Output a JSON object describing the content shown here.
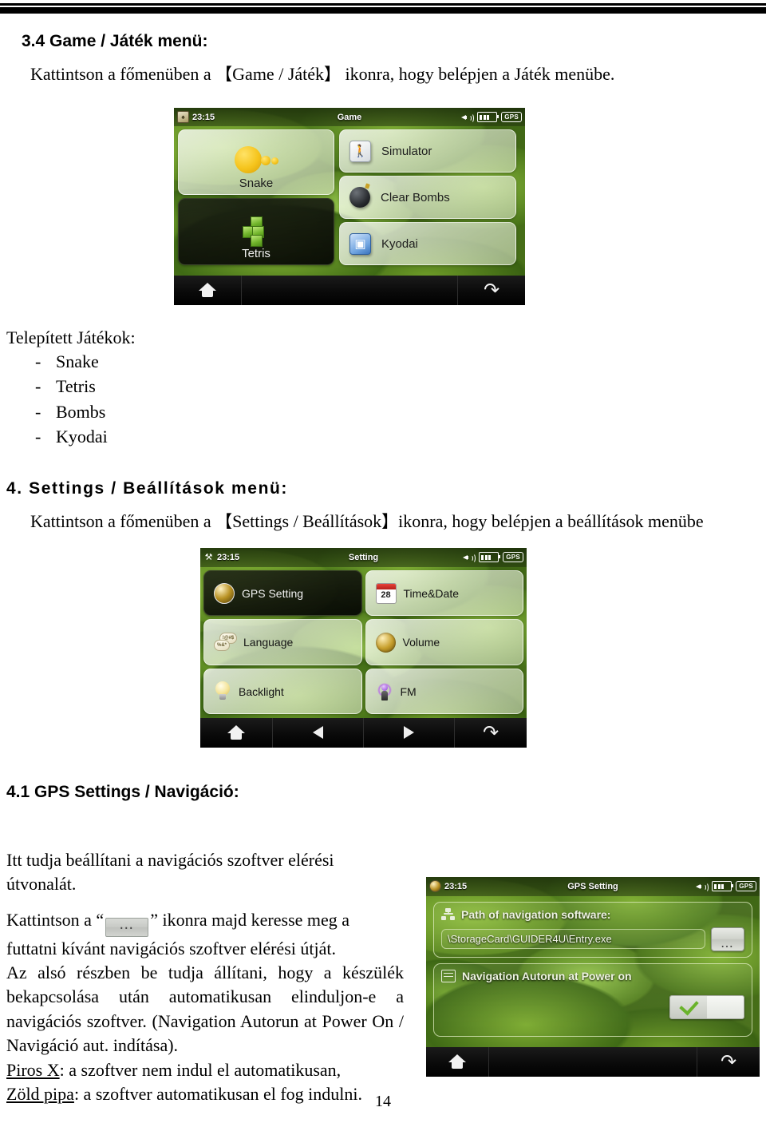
{
  "document": {
    "page_number": "14"
  },
  "section_34": {
    "heading": "3.4 Game / Játék menü:",
    "intro_before": "Kattintson a főmenüben a",
    "bracket_open": "【",
    "bracket_label": "Game / Játék",
    "bracket_close": "】",
    "intro_after": "ikonra, hogy belépjen a Játék menübe."
  },
  "game_screen": {
    "status": {
      "app_icon": "cards-icon",
      "time": "23:15",
      "title": "Game",
      "speaker_icon": "speaker-icon",
      "battery_icon": "battery-icon",
      "gps_label": "GPS"
    },
    "tiles_left": [
      {
        "label": "Snake",
        "icon": "snake-icon",
        "style": "light"
      },
      {
        "label": "Tetris",
        "icon": "tetris-icon",
        "style": "dark"
      }
    ],
    "tiles_right": [
      {
        "label": "Simulator",
        "icon": "simulator-icon"
      },
      {
        "label": "Clear Bombs",
        "icon": "bomb-icon"
      },
      {
        "label": "Kyodai",
        "icon": "kyodai-icon"
      }
    ],
    "toolbar": [
      {
        "name": "home-button",
        "icon": "home-icon"
      },
      {
        "name": "back-button",
        "icon": "back-arrow-icon"
      }
    ]
  },
  "installed_games": {
    "heading": "Telepített Játékok:",
    "bullet": "-",
    "items": [
      "Snake",
      "Tetris",
      "Bombs",
      "Kyodai"
    ]
  },
  "section_4": {
    "heading": "4. Settings / Beállítások menü:",
    "intro_before": "Kattintson a főmenüben a",
    "bracket_open": "【",
    "bracket_label": "Settings / Beállítások",
    "bracket_close": "】",
    "intro_after": "ikonra, hogy belépjen a beállítások menübe"
  },
  "settings_screen": {
    "status": {
      "app_icon": "tools-icon",
      "time": "23:15",
      "title": "Setting",
      "speaker_icon": "speaker-icon",
      "battery_icon": "battery-icon",
      "gps_label": "GPS"
    },
    "tiles": [
      {
        "label": "GPS Setting",
        "icon": "gps-globe-icon",
        "selected": true
      },
      {
        "label": "Time&Date",
        "icon": "calendar-icon",
        "day": "28"
      },
      {
        "label": "Language",
        "icon": "language-icon",
        "bubble1": "!@#$",
        "bubble2": "%&*"
      },
      {
        "label": "Volume",
        "icon": "volume-icon"
      },
      {
        "label": "Backlight",
        "icon": "lightbulb-icon"
      },
      {
        "label": "FM",
        "icon": "fm-transmitter-icon"
      }
    ],
    "toolbar": [
      {
        "name": "home-button",
        "icon": "home-icon"
      },
      {
        "name": "prev-button",
        "icon": "left-arrow-icon"
      },
      {
        "name": "next-button",
        "icon": "right-arrow-icon"
      },
      {
        "name": "back-button",
        "icon": "back-arrow-icon"
      }
    ]
  },
  "section_41": {
    "heading": "4.1 GPS Settings / Navigáció:",
    "para1": "Itt tudja beállítani a navigációs szoftver elérési útvonalát.",
    "para2_a": "Kattintson a “",
    "dots_icon_label": "…",
    "para2_b": "” ikonra majd keresse meg a futtatni kívánt navigációs szoftver elérési útját.",
    "para3": "Az alsó részben be tudja állítani, hogy a készülék bekapcsolása után automatikusan elinduljon-e a navigációs szoftver. (Navigation Autorun at Power On / Navigáció aut. indítása).",
    "legend_red_term": "Piros X",
    "legend_red_rest": ": a szoftver nem indul el automatikusan,",
    "legend_green_term": "Zöld pipa",
    "legend_green_rest": ": a szoftver automatikusan el fog indulni."
  },
  "gps_setting_screen": {
    "status": {
      "app_icon": "gps-globe-icon",
      "time": "23:15",
      "title": "GPS Setting",
      "speaker_icon": "speaker-icon",
      "battery_icon": "battery-icon",
      "gps_label": "GPS"
    },
    "path_label": "Path of navigation software:",
    "path_value": "\\StorageCard\\GUIDER4U\\Entry.exe",
    "browse_label": "…",
    "autorun_label": "Navigation Autorun at Power on",
    "autorun_state": "on",
    "toolbar": [
      {
        "name": "home-button",
        "icon": "home-icon"
      },
      {
        "name": "back-button",
        "icon": "back-arrow-icon"
      }
    ]
  }
}
